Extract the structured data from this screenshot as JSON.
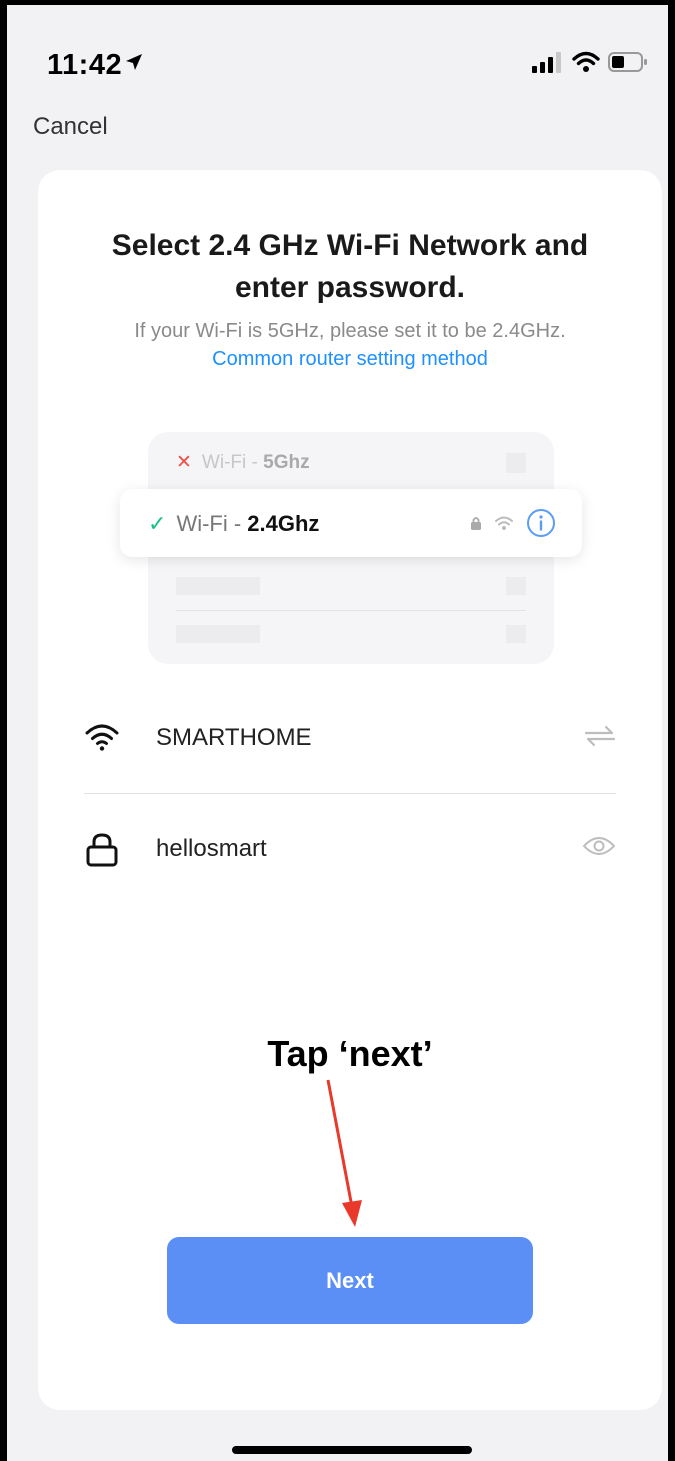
{
  "status_bar": {
    "time": "11:42"
  },
  "nav": {
    "cancel_label": "Cancel"
  },
  "card": {
    "title_line1": "Select 2.4 GHz Wi-Fi Network and",
    "title_line2": "enter password.",
    "subtitle": "If your Wi-Fi is 5GHz, please set it to be 2.4GHz.",
    "link_label": "Common router setting method"
  },
  "illustration": {
    "row_5g_prefix": "Wi-Fi - ",
    "row_5g_band": "5Ghz",
    "row_24g_prefix": "Wi-Fi - ",
    "row_24g_band": "2.4Ghz"
  },
  "wifi_field": {
    "ssid": "SMARTHOME",
    "icon": "wifi-icon",
    "action_icon": "switch-network-icon"
  },
  "password_field": {
    "value": "hellosmart",
    "icon": "lock-icon",
    "action_icon": "eye-icon"
  },
  "annotation": {
    "text": "Tap ‘next’",
    "arrow_color": "#e8392b"
  },
  "actions": {
    "next_label": "Next",
    "next_color": "#5b8ff5"
  }
}
